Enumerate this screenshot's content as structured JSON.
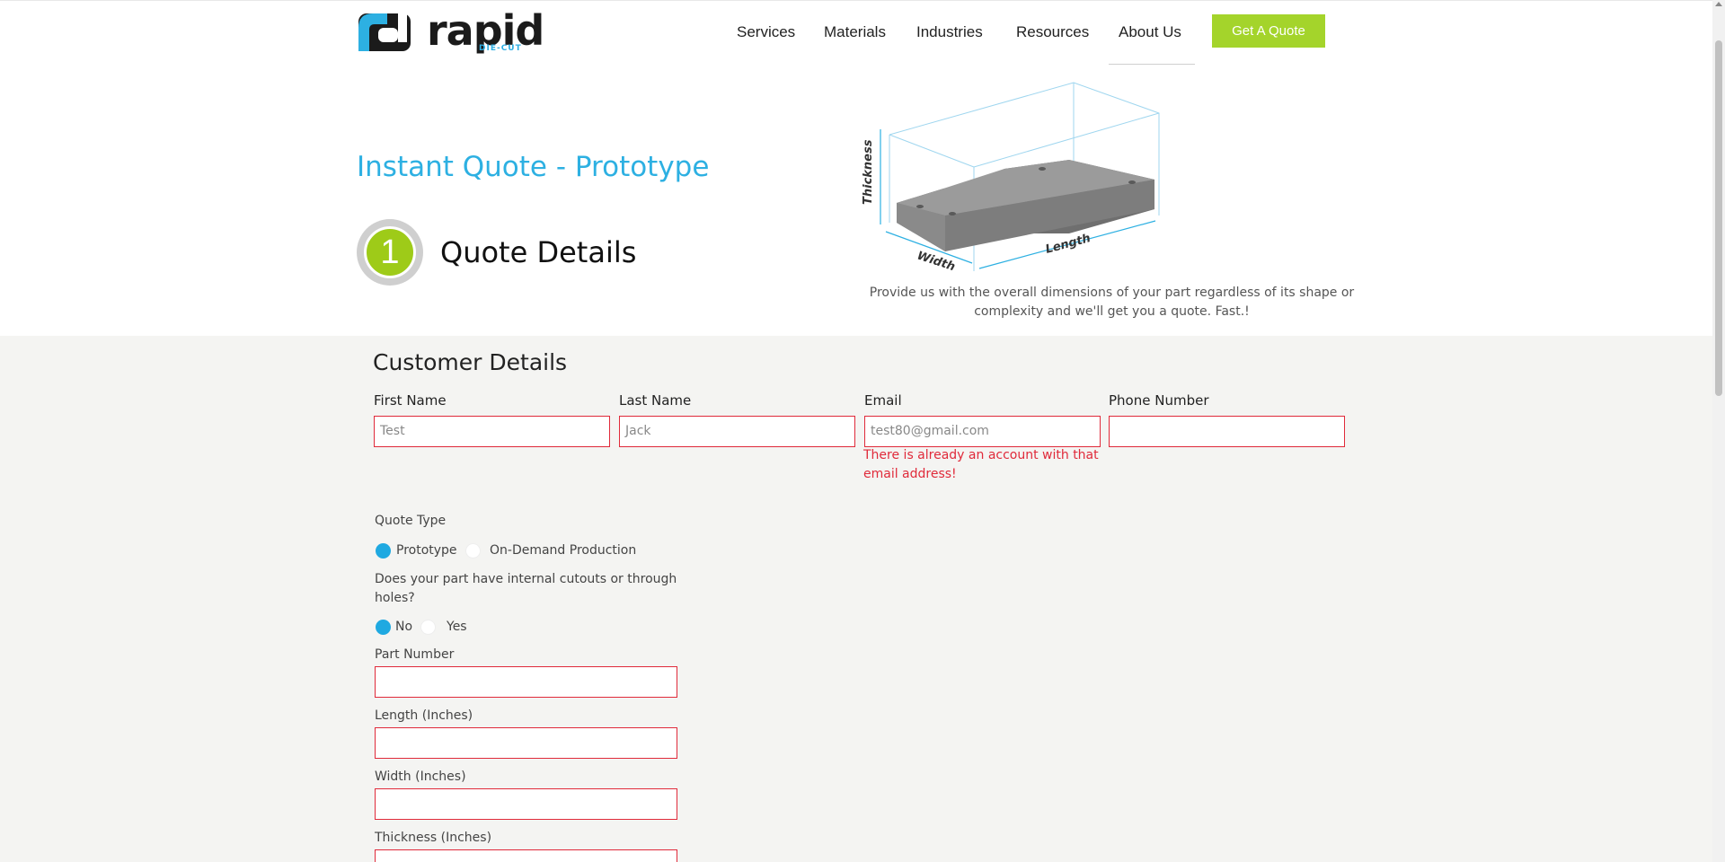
{
  "brand": {
    "name": "rapid",
    "sub": "DIE-CUT",
    "accent": "#2db0e2",
    "green": "#a4d42b"
  },
  "nav": {
    "items": [
      "Services",
      "Materials",
      "Industries",
      "Resources",
      "About Us"
    ],
    "cta": "Get A Quote"
  },
  "hero": {
    "title": "Instant Quote - Prototype",
    "step_number": "1",
    "step_title": "Quote Details",
    "illustration_labels": {
      "thickness": "Thickness",
      "width": "Width",
      "length": "Length"
    },
    "caption": "Provide us with the overall dimensions of your part regardless of its shape or complexity and we'll get you a quote. Fast.!"
  },
  "customer": {
    "title": "Customer Details",
    "first_name": {
      "label": "First Name",
      "placeholder": "Test"
    },
    "last_name": {
      "label": "Last Name",
      "placeholder": "Jack"
    },
    "email": {
      "label": "Email",
      "placeholder": "test80@gmail.com",
      "error": "There is already an account with that email address!"
    },
    "phone": {
      "label": "Phone Number",
      "placeholder": ""
    }
  },
  "quote": {
    "type_label": "Quote Type",
    "type_options": [
      "Prototype",
      "On-Demand Production"
    ],
    "type_selected": "Prototype",
    "cutouts_label": "Does your part have internal cutouts or through holes?",
    "cutouts_options": [
      "No",
      "Yes"
    ],
    "cutouts_selected": "No",
    "part_number_label": "Part Number",
    "length_label": "Length (Inches)",
    "width_label": "Width (Inches)",
    "thickness_label": "Thickness (Inches)"
  }
}
